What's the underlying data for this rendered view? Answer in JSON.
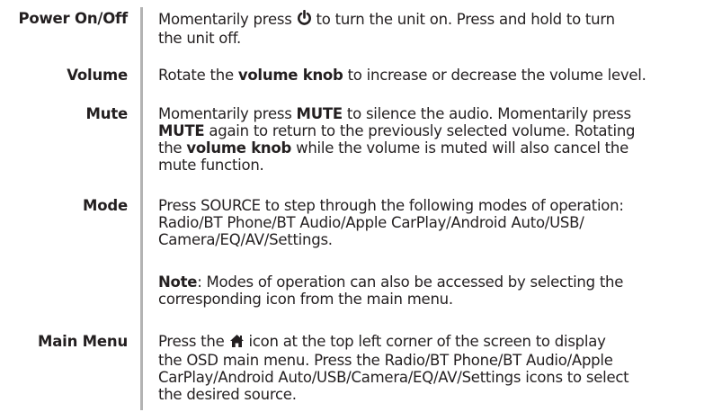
{
  "sections": {
    "power": {
      "term": "Power On/Off",
      "line1a": "Momentarily press ",
      "line1b": " to turn the unit on. Press and hold to turn",
      "line2": "the unit off.",
      "icon": "power-icon"
    },
    "volume": {
      "term": "Volume",
      "a": "Rotate the ",
      "b": "volume knob",
      "c": " to increase or decrease the volume level."
    },
    "mute": {
      "term": "Mute",
      "l1a": "Momentarily press ",
      "l1b": "MUTE",
      "l1c": " to silence the audio. Momentarily press",
      "l2a": "MUTE",
      "l2b": " again to return to the previously selected volume. Rotating",
      "l3a": "the ",
      "l3b": "volume knob",
      "l3c": " while the volume is muted will also cancel the",
      "l4": "mute function."
    },
    "mode": {
      "term": "Mode",
      "l1": "Press SOURCE to step through the following modes of operation:",
      "l2": "Radio/BT Phone/BT Audio/Apple CarPlay/Android Auto/USB/",
      "l3": "Camera/EQ/AV/Settings.",
      "note_label": "Note",
      "note_l1": ": Modes of operation can also be accessed by selecting the",
      "note_l2": "corresponding icon from the main menu."
    },
    "main_menu": {
      "term": "Main Menu",
      "l1a": "Press the ",
      "l1b": " icon at the top left corner of the screen to display",
      "l2": "the OSD main menu.  Press the Radio/BT Phone/BT Audio/Apple",
      "l3": "CarPlay/Android Auto/USB/Camera/EQ/AV/Settings icons to select",
      "l4": "the desired source.",
      "icon": "home-icon"
    }
  }
}
